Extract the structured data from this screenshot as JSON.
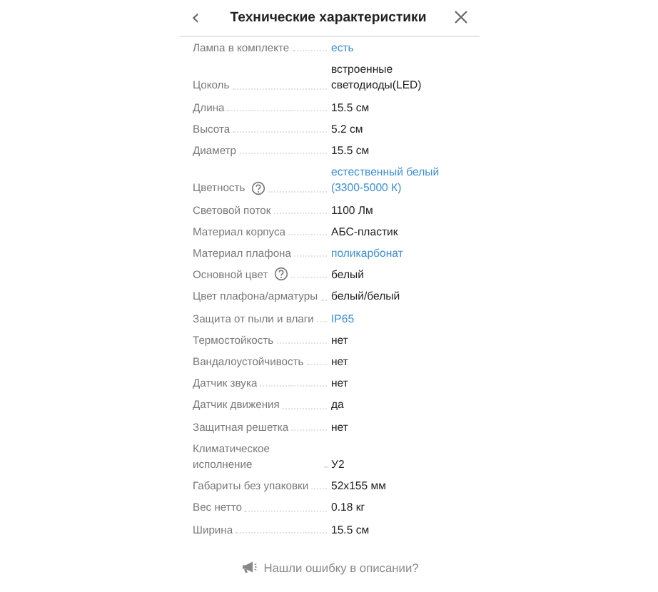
{
  "header": {
    "back": "‹",
    "title": "Технические характеристики"
  },
  "specs": [
    {
      "label": "Лампа в комплекте",
      "value": "есть",
      "link": true,
      "help": false
    },
    {
      "label": "Цоколь",
      "value": "встроенные светодиоды(LED)",
      "link": false,
      "help": false
    },
    {
      "label": "Длина",
      "value": "15.5 см",
      "link": false,
      "help": false
    },
    {
      "label": "Высота",
      "value": "5.2 см",
      "link": false,
      "help": false
    },
    {
      "label": "Диаметр",
      "value": "15.5 см",
      "link": false,
      "help": false
    },
    {
      "label": "Цветность",
      "value": "естественный белый (3300-5000 К)",
      "link": true,
      "help": true
    },
    {
      "label": "Световой поток",
      "value": "1100 Лм",
      "link": false,
      "help": false
    },
    {
      "label": "Материал корпуса",
      "value": "АБС-пластик",
      "link": false,
      "help": false
    },
    {
      "label": "Материал плафона",
      "value": "поликарбонат",
      "link": true,
      "help": false
    },
    {
      "label": "Основной цвет",
      "value": "белый",
      "link": false,
      "help": true
    },
    {
      "label": "Цвет плафона/арматуры",
      "value": "белый/белый",
      "link": false,
      "help": false
    },
    {
      "label": "Защита от пыли и влаги",
      "value": "IP65",
      "link": true,
      "help": false
    },
    {
      "label": "Термостойкость",
      "value": "нет",
      "link": false,
      "help": false
    },
    {
      "label": "Вандалоустойчивость",
      "value": "нет",
      "link": false,
      "help": false
    },
    {
      "label": "Датчик звука",
      "value": "нет",
      "link": false,
      "help": false
    },
    {
      "label": "Датчик движения",
      "value": "да",
      "link": false,
      "help": false
    },
    {
      "label": "Защитная решетка",
      "value": "нет",
      "link": false,
      "help": false
    },
    {
      "label": "Климатическое исполнение",
      "value": "У2",
      "link": false,
      "help": false
    },
    {
      "label": "Габариты без упаковки",
      "value": "52x155 мм",
      "link": false,
      "help": false
    },
    {
      "label": "Вес нетто",
      "value": "0.18 кг",
      "link": false,
      "help": false
    },
    {
      "label": "Ширина",
      "value": "15.5 см",
      "link": false,
      "help": false
    }
  ],
  "footer": {
    "report": "Нашли ошибку в описании?"
  }
}
